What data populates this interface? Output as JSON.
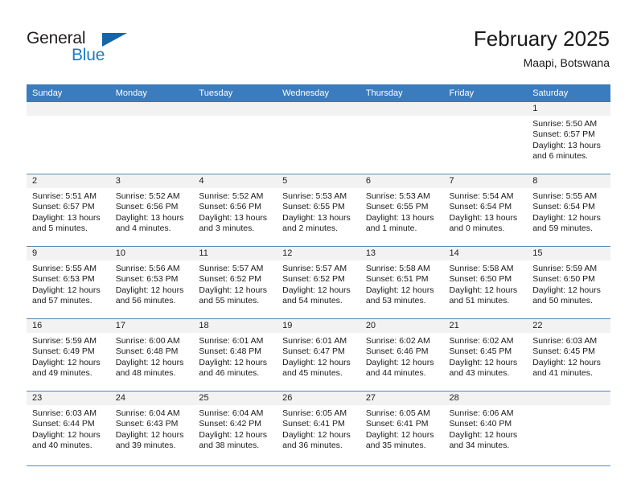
{
  "brand": {
    "name_part1": "General",
    "name_part2": "Blue",
    "triangle_color": "#1565a8",
    "blue_color": "#1f7ac2"
  },
  "header": {
    "title": "February 2025",
    "subtitle": "Maapi, Botswana",
    "header_bg": "#3a7cbe",
    "row_divider": "#5b88b5",
    "daynum_bg": "#f2f2f2"
  },
  "weekdays": [
    "Sunday",
    "Monday",
    "Tuesday",
    "Wednesday",
    "Thursday",
    "Friday",
    "Saturday"
  ],
  "weeks": [
    [
      {
        "day": "",
        "sunrise": "",
        "sunset": "",
        "daylight": ""
      },
      {
        "day": "",
        "sunrise": "",
        "sunset": "",
        "daylight": ""
      },
      {
        "day": "",
        "sunrise": "",
        "sunset": "",
        "daylight": ""
      },
      {
        "day": "",
        "sunrise": "",
        "sunset": "",
        "daylight": ""
      },
      {
        "day": "",
        "sunrise": "",
        "sunset": "",
        "daylight": ""
      },
      {
        "day": "",
        "sunrise": "",
        "sunset": "",
        "daylight": ""
      },
      {
        "day": "1",
        "sunrise": "Sunrise: 5:50 AM",
        "sunset": "Sunset: 6:57 PM",
        "daylight": "Daylight: 13 hours and 6 minutes."
      }
    ],
    [
      {
        "day": "2",
        "sunrise": "Sunrise: 5:51 AM",
        "sunset": "Sunset: 6:57 PM",
        "daylight": "Daylight: 13 hours and 5 minutes."
      },
      {
        "day": "3",
        "sunrise": "Sunrise: 5:52 AM",
        "sunset": "Sunset: 6:56 PM",
        "daylight": "Daylight: 13 hours and 4 minutes."
      },
      {
        "day": "4",
        "sunrise": "Sunrise: 5:52 AM",
        "sunset": "Sunset: 6:56 PM",
        "daylight": "Daylight: 13 hours and 3 minutes."
      },
      {
        "day": "5",
        "sunrise": "Sunrise: 5:53 AM",
        "sunset": "Sunset: 6:55 PM",
        "daylight": "Daylight: 13 hours and 2 minutes."
      },
      {
        "day": "6",
        "sunrise": "Sunrise: 5:53 AM",
        "sunset": "Sunset: 6:55 PM",
        "daylight": "Daylight: 13 hours and 1 minute."
      },
      {
        "day": "7",
        "sunrise": "Sunrise: 5:54 AM",
        "sunset": "Sunset: 6:54 PM",
        "daylight": "Daylight: 13 hours and 0 minutes."
      },
      {
        "day": "8",
        "sunrise": "Sunrise: 5:55 AM",
        "sunset": "Sunset: 6:54 PM",
        "daylight": "Daylight: 12 hours and 59 minutes."
      }
    ],
    [
      {
        "day": "9",
        "sunrise": "Sunrise: 5:55 AM",
        "sunset": "Sunset: 6:53 PM",
        "daylight": "Daylight: 12 hours and 57 minutes."
      },
      {
        "day": "10",
        "sunrise": "Sunrise: 5:56 AM",
        "sunset": "Sunset: 6:53 PM",
        "daylight": "Daylight: 12 hours and 56 minutes."
      },
      {
        "day": "11",
        "sunrise": "Sunrise: 5:57 AM",
        "sunset": "Sunset: 6:52 PM",
        "daylight": "Daylight: 12 hours and 55 minutes."
      },
      {
        "day": "12",
        "sunrise": "Sunrise: 5:57 AM",
        "sunset": "Sunset: 6:52 PM",
        "daylight": "Daylight: 12 hours and 54 minutes."
      },
      {
        "day": "13",
        "sunrise": "Sunrise: 5:58 AM",
        "sunset": "Sunset: 6:51 PM",
        "daylight": "Daylight: 12 hours and 53 minutes."
      },
      {
        "day": "14",
        "sunrise": "Sunrise: 5:58 AM",
        "sunset": "Sunset: 6:50 PM",
        "daylight": "Daylight: 12 hours and 51 minutes."
      },
      {
        "day": "15",
        "sunrise": "Sunrise: 5:59 AM",
        "sunset": "Sunset: 6:50 PM",
        "daylight": "Daylight: 12 hours and 50 minutes."
      }
    ],
    [
      {
        "day": "16",
        "sunrise": "Sunrise: 5:59 AM",
        "sunset": "Sunset: 6:49 PM",
        "daylight": "Daylight: 12 hours and 49 minutes."
      },
      {
        "day": "17",
        "sunrise": "Sunrise: 6:00 AM",
        "sunset": "Sunset: 6:48 PM",
        "daylight": "Daylight: 12 hours and 48 minutes."
      },
      {
        "day": "18",
        "sunrise": "Sunrise: 6:01 AM",
        "sunset": "Sunset: 6:48 PM",
        "daylight": "Daylight: 12 hours and 46 minutes."
      },
      {
        "day": "19",
        "sunrise": "Sunrise: 6:01 AM",
        "sunset": "Sunset: 6:47 PM",
        "daylight": "Daylight: 12 hours and 45 minutes."
      },
      {
        "day": "20",
        "sunrise": "Sunrise: 6:02 AM",
        "sunset": "Sunset: 6:46 PM",
        "daylight": "Daylight: 12 hours and 44 minutes."
      },
      {
        "day": "21",
        "sunrise": "Sunrise: 6:02 AM",
        "sunset": "Sunset: 6:45 PM",
        "daylight": "Daylight: 12 hours and 43 minutes."
      },
      {
        "day": "22",
        "sunrise": "Sunrise: 6:03 AM",
        "sunset": "Sunset: 6:45 PM",
        "daylight": "Daylight: 12 hours and 41 minutes."
      }
    ],
    [
      {
        "day": "23",
        "sunrise": "Sunrise: 6:03 AM",
        "sunset": "Sunset: 6:44 PM",
        "daylight": "Daylight: 12 hours and 40 minutes."
      },
      {
        "day": "24",
        "sunrise": "Sunrise: 6:04 AM",
        "sunset": "Sunset: 6:43 PM",
        "daylight": "Daylight: 12 hours and 39 minutes."
      },
      {
        "day": "25",
        "sunrise": "Sunrise: 6:04 AM",
        "sunset": "Sunset: 6:42 PM",
        "daylight": "Daylight: 12 hours and 38 minutes."
      },
      {
        "day": "26",
        "sunrise": "Sunrise: 6:05 AM",
        "sunset": "Sunset: 6:41 PM",
        "daylight": "Daylight: 12 hours and 36 minutes."
      },
      {
        "day": "27",
        "sunrise": "Sunrise: 6:05 AM",
        "sunset": "Sunset: 6:41 PM",
        "daylight": "Daylight: 12 hours and 35 minutes."
      },
      {
        "day": "28",
        "sunrise": "Sunrise: 6:06 AM",
        "sunset": "Sunset: 6:40 PM",
        "daylight": "Daylight: 12 hours and 34 minutes."
      },
      {
        "day": "",
        "sunrise": "",
        "sunset": "",
        "daylight": ""
      }
    ]
  ]
}
